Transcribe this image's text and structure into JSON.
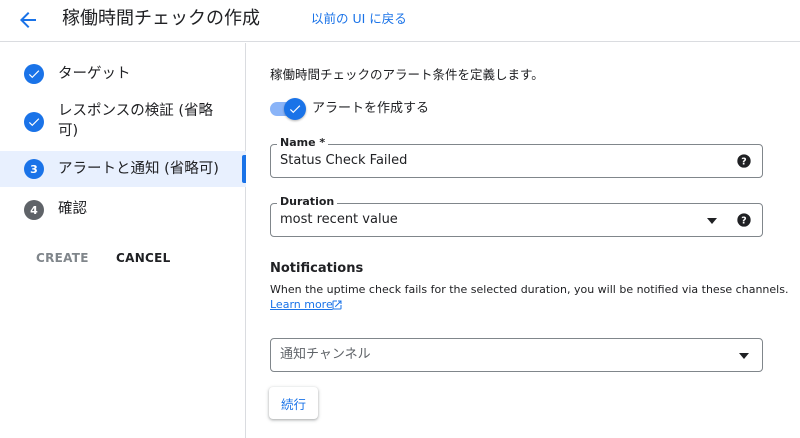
{
  "header": {
    "title": "稼働時間チェックの作成",
    "legacy_link": "以前の UI に戻る"
  },
  "stepper": {
    "steps": [
      {
        "label": "ターゲット",
        "state": "done",
        "number": ""
      },
      {
        "label": "レスポンスの検証 (省略可)",
        "state": "done",
        "number": ""
      },
      {
        "label": "アラートと通知 (省略可)",
        "state": "active",
        "number": "3"
      },
      {
        "label": "確認",
        "state": "pending",
        "number": "4"
      }
    ],
    "create_label": "CREATE",
    "cancel_label": "CANCEL"
  },
  "main": {
    "intro": "稼働時間チェックのアラート条件を定義します。",
    "toggle": {
      "label": "アラートを作成する",
      "on": true
    },
    "name_field": {
      "label": "Name *",
      "value": "Status Check Failed"
    },
    "duration_field": {
      "label": "Duration",
      "value": "most recent value"
    },
    "notifications": {
      "title": "Notifications",
      "description": "When the uptime check fails for the selected duration, you will be notified via these channels.",
      "learn_more": "Learn more"
    },
    "channel_select": {
      "placeholder": "通知チャンネル"
    },
    "continue_label": "続行"
  },
  "colors": {
    "accent": "#1a73e8",
    "toggle_track": "#8ab4f8",
    "active_step_bg": "#e8f0fe",
    "border": "#dadce0"
  }
}
